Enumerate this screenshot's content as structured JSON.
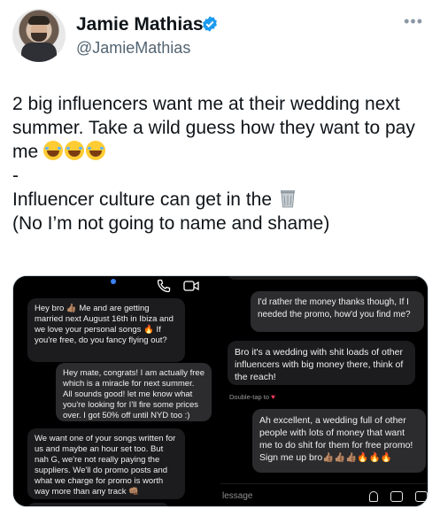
{
  "author": {
    "name": "Jamie Mathias",
    "handle": "@JamieMathias",
    "verified": true
  },
  "more_label": "•••",
  "tweet": {
    "line1": "2 big influencers want me at their wedding next summer. Take a wild guess how they want to pay me",
    "emojis": [
      "face-with-tears-of-joy",
      "face-with-tears-of-joy",
      "face-with-tears-of-joy"
    ],
    "separator": "-",
    "line2": "Influencer culture can get in the",
    "line2_emoji": "wastebasket",
    "line3": "(No I’m not going to name and shame)"
  },
  "screenshot_left": {
    "messages": [
      {
        "direction": "incoming",
        "text": "Hey bro 👍🏽 Me and                are getting married next August 16th in Ibiza and we love your personal songs 🔥 If you're free, do you fancy flying out?"
      },
      {
        "direction": "outgoing",
        "text": "Hey mate, congrats! I am actually free which is a miracle for next summer. All sounds good! let me know what you're looking for I'll fire some prices over. I got 50% off until NYD too :)"
      },
      {
        "direction": "incoming",
        "text": "We want one of your songs written for us and maybe an hour set too. But nah G, we're not really paying the suppliers. We'll do promo posts and what we charge for promo is worth way more than any track 👊🏽"
      }
    ]
  },
  "screenshot_right": {
    "messages": [
      {
        "direction": "outgoing",
        "text": "I'd rather the money thanks though, If I needed the promo, how'd you find me?"
      },
      {
        "direction": "incoming",
        "text": "Bro it's a wedding with shit loads of other influencers with big money there, think of the reach!"
      },
      {
        "direction": "outgoing",
        "text": "Ah excellent, a wedding full of other people with lots of money that want me to do shit for them for free promo! Sign me up bro👍🏽👍🏽👍🏽🔥🔥🔥"
      }
    ],
    "double_tap_label": "Double-tap to",
    "compose_placeholder": "lessage"
  },
  "colors": {
    "verified": "#1d9bf0",
    "handle": "#536471",
    "bubble_dark": "#1c1c1e",
    "bubble_out": "#2c2c2e"
  }
}
